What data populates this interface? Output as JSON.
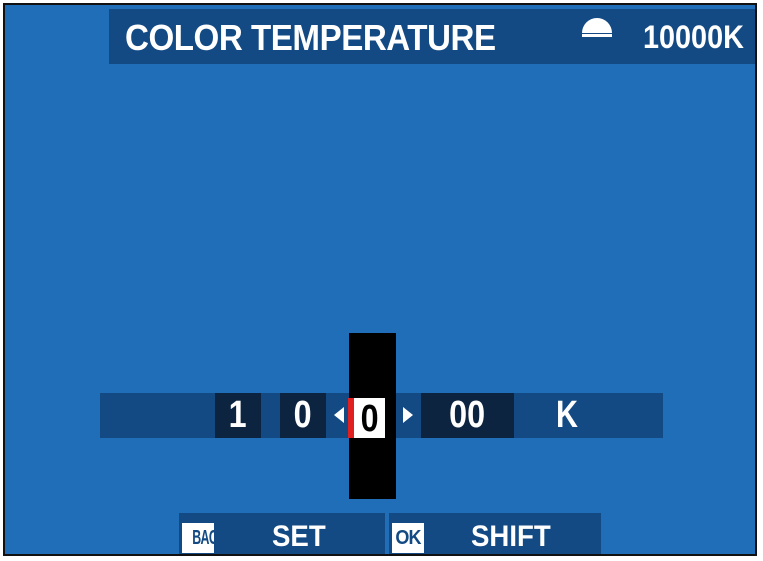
{
  "header": {
    "title": "COLOR TEMPERATURE",
    "icon": "sun-icon",
    "current_value": "10000K"
  },
  "editor": {
    "digits": [
      "1",
      "0",
      "0",
      "00"
    ],
    "selected_index": 2,
    "unit": "K"
  },
  "footer": {
    "back_key": "BACK",
    "back_label": "SET",
    "ok_key": "OK",
    "ok_label": "SHIFT"
  },
  "colors": {
    "background": "#1f6eb7",
    "bar": "#134a84",
    "digit_box": "#0c2440",
    "cursor": "#000000",
    "selected_marker": "#e02020"
  }
}
